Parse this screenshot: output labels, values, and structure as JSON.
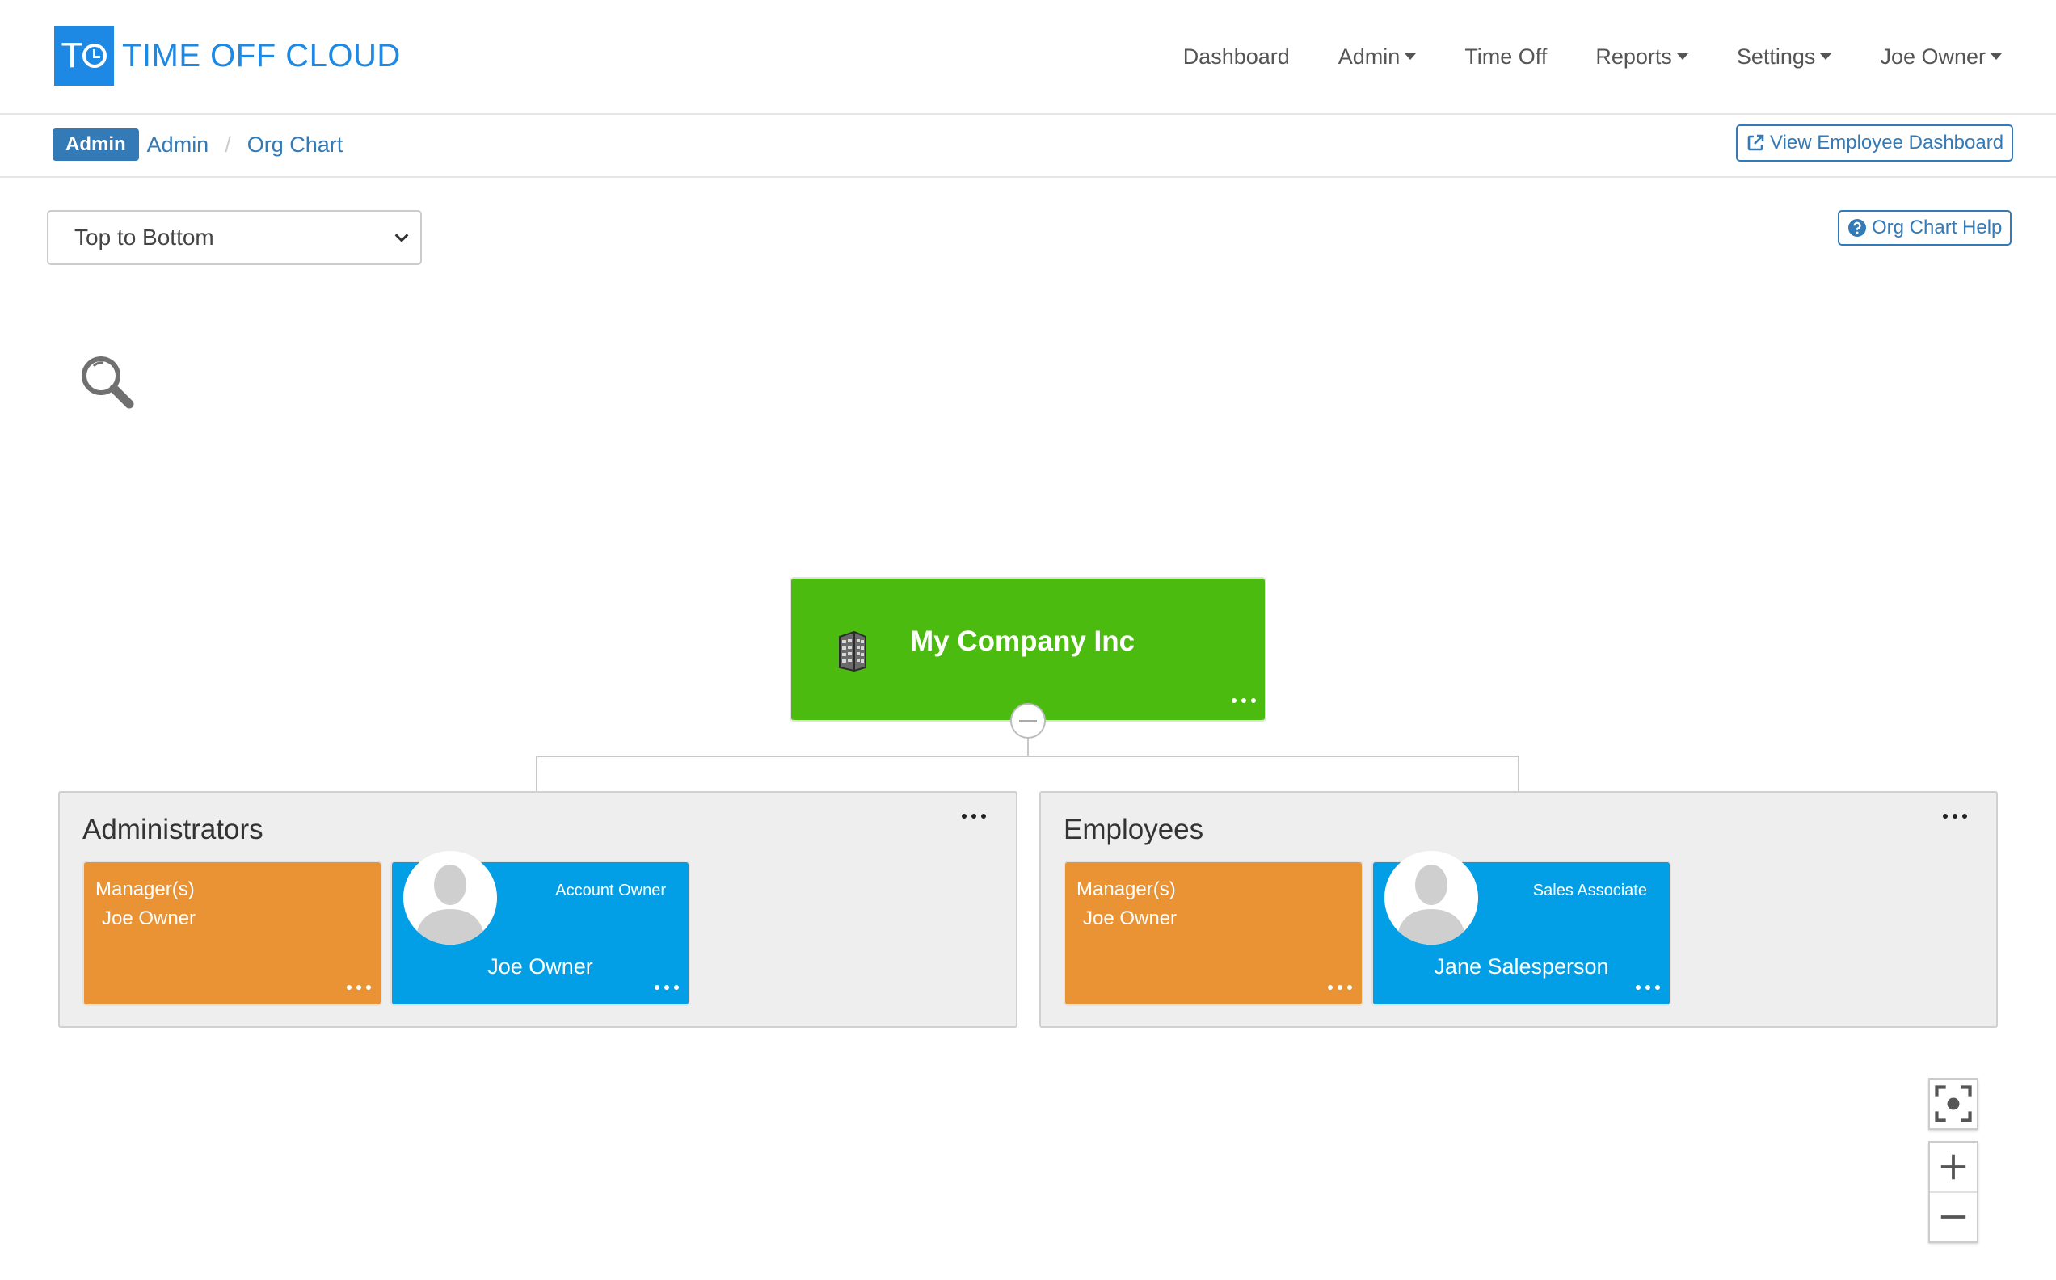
{
  "app": {
    "logo_mark": "TO",
    "logo_text": "TIME OFF CLOUD"
  },
  "nav": {
    "items": [
      {
        "label": "Dashboard",
        "dropdown": false
      },
      {
        "label": "Admin",
        "dropdown": true
      },
      {
        "label": "Time Off",
        "dropdown": false
      },
      {
        "label": "Reports",
        "dropdown": true
      },
      {
        "label": "Settings",
        "dropdown": true
      },
      {
        "label": "Joe Owner",
        "dropdown": true
      }
    ]
  },
  "breadcrumb": {
    "badge": "Admin",
    "items": [
      "Admin",
      "Org Chart"
    ],
    "separator": "/"
  },
  "actions": {
    "view_dashboard": "View Employee Dashboard",
    "help": "Org Chart Help"
  },
  "layout_select": {
    "value": "Top to Bottom"
  },
  "org": {
    "root": {
      "name": "My Company Inc",
      "color": "#4cbb10"
    },
    "groups": [
      {
        "title": "Administrators",
        "manager_label": "Manager(s)",
        "manager_name": "Joe Owner",
        "person": {
          "role": "Account Owner",
          "name": "Joe Owner"
        }
      },
      {
        "title": "Employees",
        "manager_label": "Manager(s)",
        "manager_name": "Joe Owner",
        "person": {
          "role": "Sales Associate",
          "name": "Jane Salesperson"
        }
      }
    ]
  },
  "colors": {
    "brand": "#1e88e5",
    "link": "#337ab7",
    "manager_card": "#ea9335",
    "person_card": "#029fe6",
    "group_bg": "#eeeeee"
  },
  "icons": {
    "search": "magnifier-icon",
    "company": "building-icon",
    "fit": "fit-screen-icon",
    "zoom_in": "plus-icon",
    "zoom_out": "minus-icon"
  }
}
